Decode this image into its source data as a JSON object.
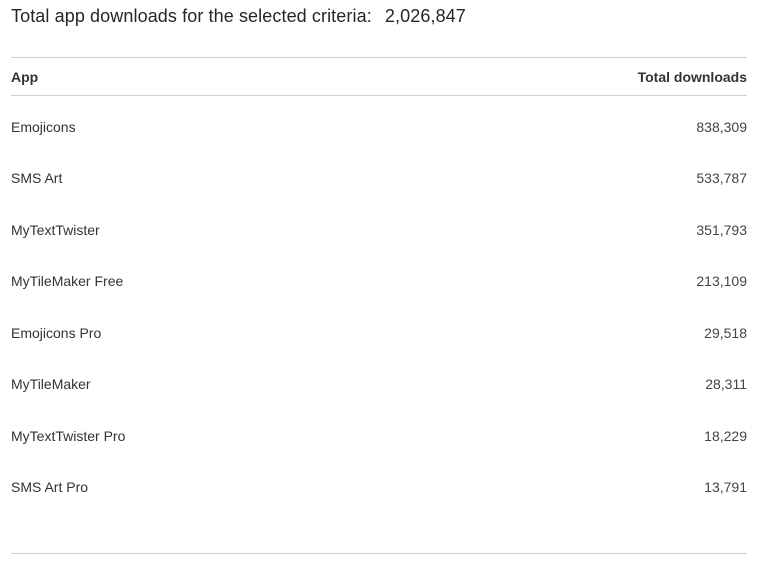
{
  "summary": {
    "label": "Total app downloads for the selected criteria:",
    "total": "2,026,847"
  },
  "table": {
    "columns": {
      "app": "App",
      "downloads": "Total downloads"
    },
    "rows": [
      {
        "app": "Emojicons",
        "downloads": "838,309"
      },
      {
        "app": "SMS Art",
        "downloads": "533,787"
      },
      {
        "app": "MyTextTwister",
        "downloads": "351,793"
      },
      {
        "app": "MyTileMaker Free",
        "downloads": "213,109"
      },
      {
        "app": "Emojicons Pro",
        "downloads": "29,518"
      },
      {
        "app": "MyTileMaker",
        "downloads": "28,311"
      },
      {
        "app": "MyTextTwister Pro",
        "downloads": "18,229"
      },
      {
        "app": "SMS Art Pro",
        "downloads": "13,791"
      }
    ]
  },
  "colors": {
    "rule": "#cfcfcf",
    "text": "#333333"
  }
}
